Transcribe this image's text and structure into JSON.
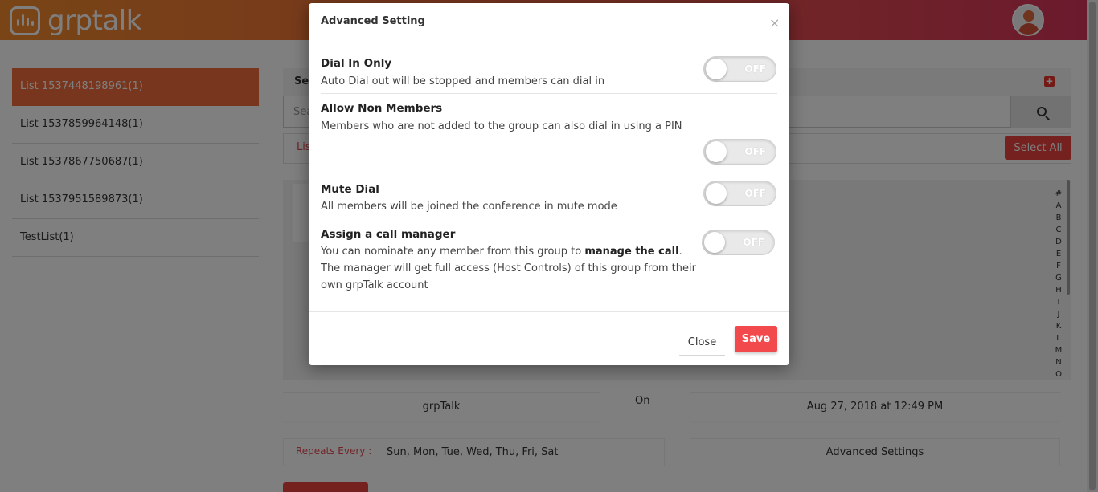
{
  "app": {
    "logo_text": "grptalk"
  },
  "sidebar": {
    "items": [
      {
        "label": "List 1537448198961(1)"
      },
      {
        "label": "List 1537859964148(1)"
      },
      {
        "label": "List 1537867750687(1)"
      },
      {
        "label": "List 1537951589873(1)"
      },
      {
        "label": "TestList(1)"
      }
    ]
  },
  "main": {
    "panel_title": "Se",
    "search_placeholder": "Sea",
    "tab_label": "Lis",
    "select_all_label": "Select All",
    "alphabet": [
      "#",
      "A",
      "B",
      "C",
      "D",
      "E",
      "F",
      "G",
      "H",
      "I",
      "J",
      "K",
      "L",
      "M",
      "N",
      "O"
    ],
    "group_name": "grpTalk",
    "on_label": "On",
    "datetime": "Aug 27, 2018 at 12:49 PM",
    "repeats_label": "Repeats Every :",
    "repeats_value": "Sun, Mon, Tue, Wed, Thu, Fri, Sat",
    "advanced_settings_label": "Advanced Settings"
  },
  "modal": {
    "title": "Advanced Setting",
    "close_icon": "×",
    "settings": [
      {
        "name": "Dial In Only",
        "desc": "Auto Dial out will be stopped and members can dial in",
        "state": "OFF"
      },
      {
        "name": "Allow Non Members",
        "desc": "Members who are not added to the group can also dial in using a PIN",
        "state": "OFF"
      },
      {
        "name": "Mute Dial",
        "desc": "All members will be joined the conference in mute mode",
        "state": "OFF"
      },
      {
        "name": "Assign a call manager",
        "desc_part1": "You can nominate any member from this group to ",
        "desc_bold": "manage the call",
        "desc_part2": ". The manager will get full access (Host Controls) of this group from their own grpTalk account",
        "state": "OFF"
      }
    ],
    "close_label": "Close",
    "save_label": "Save"
  },
  "colors": {
    "accent": "#ee6d3a",
    "danger": "#e8433f",
    "save": "#f2494c"
  }
}
